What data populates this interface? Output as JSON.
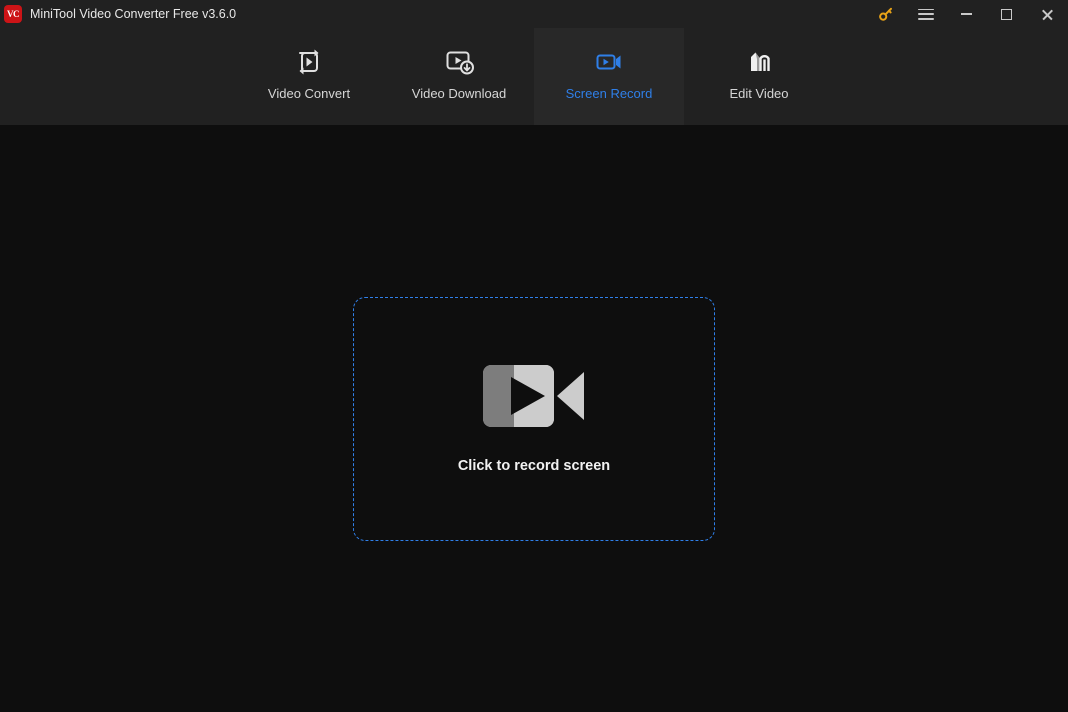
{
  "window": {
    "logo_text": "VC",
    "title": "MiniTool Video Converter Free v3.6.0",
    "controls": {
      "key_label": "key-icon",
      "menu_label": "menu-icon",
      "minimize_label": "minimize-icon",
      "maximize_label": "maximize-icon",
      "close_label": "close-icon"
    }
  },
  "nav": {
    "tabs": [
      {
        "label": "Video Convert",
        "icon": "video-convert-icon",
        "active": false
      },
      {
        "label": "Video Download",
        "icon": "video-download-icon",
        "active": false
      },
      {
        "label": "Screen Record",
        "icon": "screen-record-icon",
        "active": true
      },
      {
        "label": "Edit Video",
        "icon": "edit-video-icon",
        "active": false
      }
    ]
  },
  "main": {
    "dropzone": {
      "icon": "camcorder-icon",
      "text": "Click to record screen"
    }
  },
  "colors": {
    "accent_blue": "#2f7fe8",
    "titlebar_bg": "#212121",
    "content_bg": "#0e0e0e",
    "active_tab_bg": "#282828",
    "logo_red": "#cc1417",
    "key_gold": "#e8a317"
  }
}
